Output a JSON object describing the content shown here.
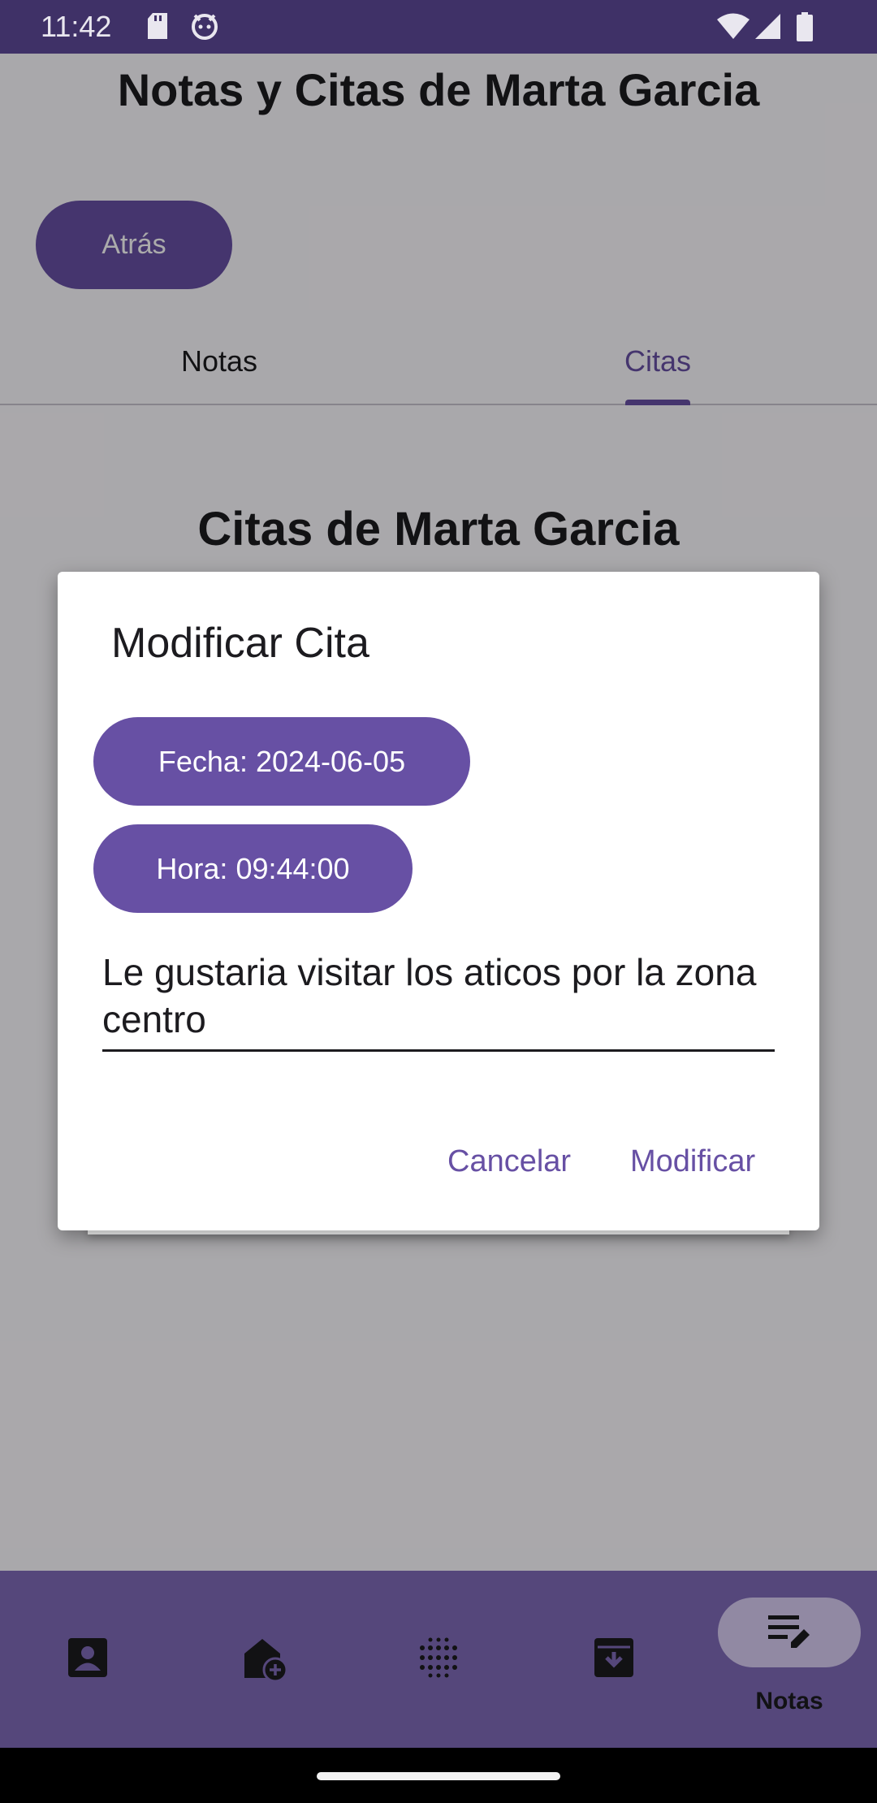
{
  "status_bar": {
    "time": "11:42",
    "left_icons": [
      "sd-card-icon",
      "cat-icon"
    ],
    "right_icons": [
      "wifi-icon",
      "signal-icon",
      "battery-icon"
    ]
  },
  "page": {
    "title": "Notas y Citas de Marta Garcia",
    "back_label": "Atrás",
    "tabs": [
      {
        "label": "Notas",
        "selected": false
      },
      {
        "label": "Citas",
        "selected": true
      }
    ],
    "section_title": "Citas de Marta Garcia"
  },
  "dialog": {
    "title": "Modificar Cita",
    "date_button": "Fecha: 2024-06-05",
    "time_button": "Hora: 09:44:00",
    "note_value": "Le gustaria visitar los aticos por la zona centro",
    "cancel_label": "Cancelar",
    "confirm_label": "Modificar"
  },
  "bottom_nav": {
    "items": [
      {
        "icon": "contact-icon",
        "label": ""
      },
      {
        "icon": "add-home-icon",
        "label": ""
      },
      {
        "icon": "dots-grid-icon",
        "label": ""
      },
      {
        "icon": "archive-icon",
        "label": ""
      },
      {
        "icon": "notes-edit-icon",
        "label": "Notas",
        "selected": true
      }
    ]
  },
  "colors": {
    "primary": "#6750a4",
    "status_bar": "#3f3167",
    "nav_bar": "#7f6ab8",
    "selected_pill": "#d9cdf4"
  }
}
